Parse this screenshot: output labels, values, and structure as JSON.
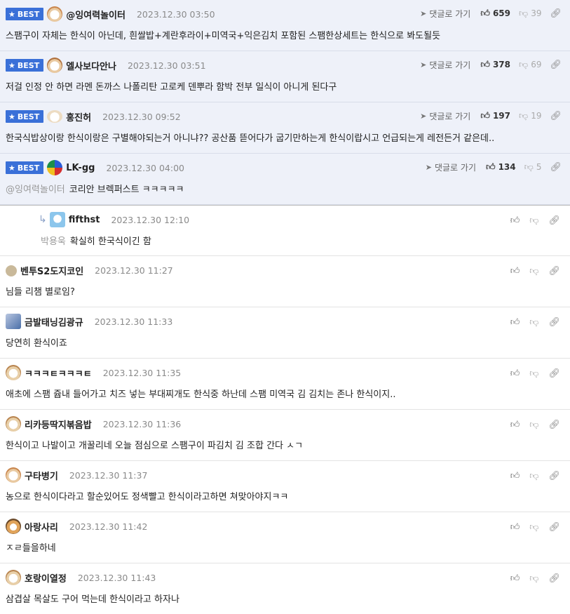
{
  "labels": {
    "best": "BEST",
    "goto": "댓글로 가기"
  },
  "colors": {
    "best_bg": "#eef1f9",
    "badge": "#3a70d8",
    "mention": "#9a9a9a"
  },
  "best_comments": [
    {
      "nick": "@잉여력놀이터",
      "date": "2023.12.30 03:50",
      "up": "659",
      "down": "39",
      "text": "스팸구이 자체는 한식이 아닌데, 흰쌀밥+계란후라이+미역국+익은김치 포함된 스팸한상세트는 한식으로 봐도될듯",
      "mention": ""
    },
    {
      "nick": "엘사보다안나",
      "date": "2023.12.30 03:51",
      "up": "378",
      "down": "69",
      "text": "저걸 인정 안 하면 라멘 돈까스 나폴리탄 고로케 덴뿌라 함박 전부 일식이 아니게 된다구",
      "mention": ""
    },
    {
      "nick": "홍진허",
      "date": "2023.12.30 09:52",
      "up": "197",
      "down": "19",
      "text": "한국식밥상이랑 한식이랑은 구별해야되는거 아니냐?? 공산품 뜯어다가 굽기만하는게 한식이랍시고 언급되는게 레전든거 같은데..",
      "mention": ""
    },
    {
      "nick": "LK-gg",
      "date": "2023.12.30 04:00",
      "up": "134",
      "down": "5",
      "text": "코리안 브렉퍼스트 ㅋㅋㅋㅋㅋ",
      "mention": "@잉여력놀이터"
    }
  ],
  "reply": {
    "nick": "fifthst",
    "date": "2023.12.30 12:10",
    "mention": "박용욱",
    "text": "확실히 한국식이긴 함"
  },
  "comments": [
    {
      "nick": "벤투S2도지코인",
      "date": "2023.12.30 11:27",
      "text": "님들 리챔 별로임?"
    },
    {
      "nick": "금발태닝김광규",
      "date": "2023.12.30 11:33",
      "text": "당연히 환식이죠"
    },
    {
      "nick": "ㅋㅋㅋㅌㅋㅋㅋㅌ",
      "date": "2023.12.30 11:35",
      "text": "애초에 스팸 쥽내 들어가고 치즈 넣는 부대찌개도 한식중 하난데 스팸 미역국 김 김치는 존나 한식이지.."
    },
    {
      "nick": "리카등딱지볶음밥",
      "date": "2023.12.30 11:36",
      "text": "한식이고 나발이고 개꿀리네 오늘 점심으로 스팸구이 파김치 김 조합 간다 ㅅㄱ"
    },
    {
      "nick": "구타병기",
      "date": "2023.12.30 11:37",
      "text": "농으로 한식이다라고 할순있어도 정색빨고 한식이라고하면 쳐맞아야지ㅋㅋ"
    },
    {
      "nick": "아랑사리",
      "date": "2023.12.30 11:42",
      "text": "ㅈㄹ들을하네"
    },
    {
      "nick": "호랑이열정",
      "date": "2023.12.30 11:43",
      "text": "삼겹살 목살도 구어 먹는데 한식이라고 하자나"
    }
  ]
}
